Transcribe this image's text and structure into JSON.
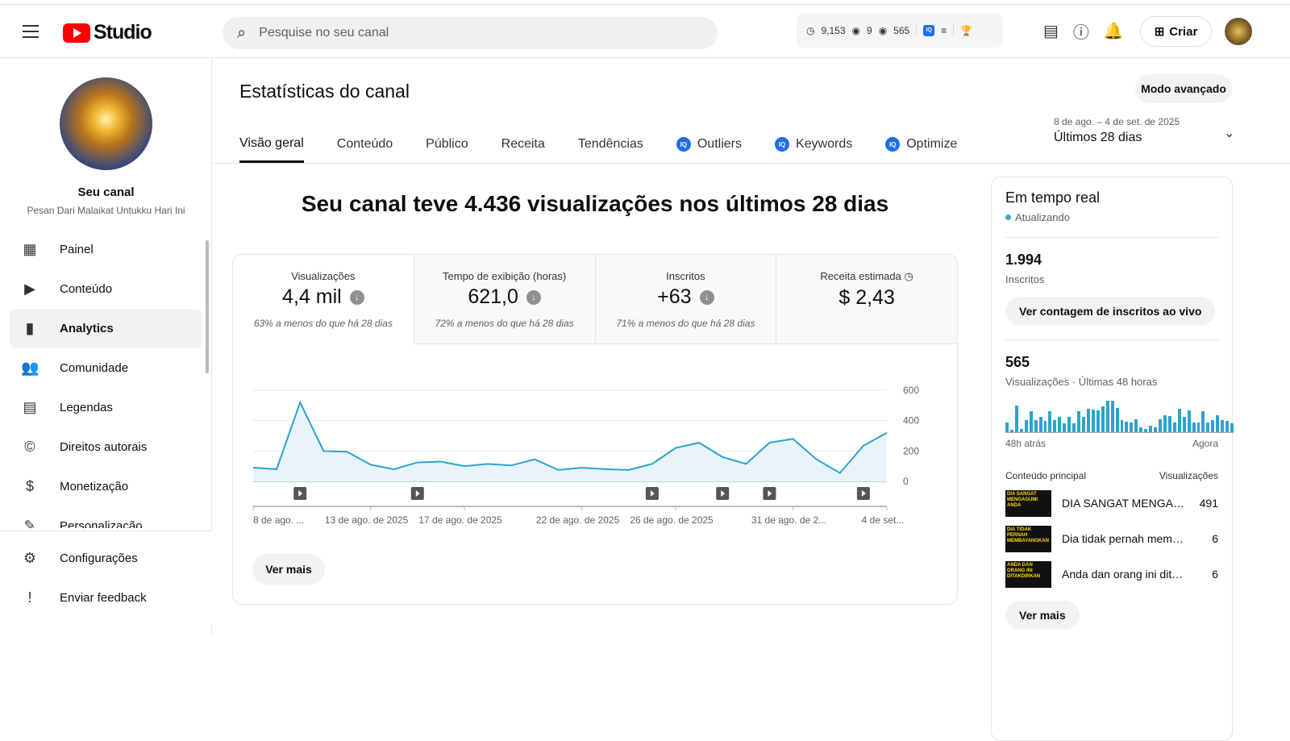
{
  "header": {
    "app": "Studio",
    "search_placeholder": "Pesquise no seu canal",
    "ext_stats": [
      "9,153",
      "9",
      "565"
    ],
    "create_label": "Criar"
  },
  "channel": {
    "title": "Seu canal",
    "name": "Pesan Dari Malaikat Untukku Hari Ini"
  },
  "sidebar": {
    "items": [
      {
        "label": "Painel",
        "icon": "dashboard-icon",
        "glyph": "▦"
      },
      {
        "label": "Conteúdo",
        "icon": "content-icon",
        "glyph": "▶"
      },
      {
        "label": "Analytics",
        "icon": "analytics-icon",
        "glyph": "▮"
      },
      {
        "label": "Comunidade",
        "icon": "community-icon",
        "glyph": "👥"
      },
      {
        "label": "Legendas",
        "icon": "subtitles-icon",
        "glyph": "▤"
      },
      {
        "label": "Direitos autorais",
        "icon": "copyright-icon",
        "glyph": "©"
      },
      {
        "label": "Monetização",
        "icon": "monetization-icon",
        "glyph": "$"
      },
      {
        "label": "Personalização",
        "icon": "customization-icon",
        "glyph": "✎"
      }
    ],
    "bottom": [
      {
        "label": "Configurações",
        "glyph": "⚙"
      },
      {
        "label": "Enviar feedback",
        "glyph": "!"
      }
    ]
  },
  "page": {
    "title": "Estatísticas do canal",
    "advanced_mode": "Modo avançado",
    "tabs": [
      "Visão geral",
      "Conteúdo",
      "Público",
      "Receita",
      "Tendências",
      "Outliers",
      "Keywords",
      "Optimize"
    ],
    "date_range": "8 de ago. – 4 de set. de 2025",
    "period": "Últimos 28 dias",
    "headline": "Seu canal teve 4.436 visualizações nos últimos 28 dias",
    "metrics": [
      {
        "label": "Visualizações",
        "value": "4,4 mil",
        "change": "63% a menos do que há 28 dias"
      },
      {
        "label": "Tempo de exibição (horas)",
        "value": "621,0",
        "change": "72% a menos do que há 28 dias"
      },
      {
        "label": "Inscritos",
        "value": "+63",
        "change": "71% a menos do que há 28 dias"
      },
      {
        "label": "Receita estimada",
        "value": "$ 2,43"
      }
    ],
    "see_more": "Ver mais"
  },
  "chart_data": {
    "type": "area",
    "series": [
      {
        "name": "Visualizações",
        "values": [
          90,
          80,
          520,
          200,
          195,
          110,
          80,
          125,
          130,
          100,
          115,
          105,
          145,
          75,
          90,
          80,
          75,
          115,
          220,
          255,
          160,
          115,
          255,
          280,
          145,
          55,
          235,
          320
        ]
      }
    ],
    "ylim": [
      0,
      600
    ],
    "yticks": [
      "0",
      "200",
      "400",
      "600"
    ],
    "xticks": [
      {
        "i": 0,
        "label": "8 de ago. ..."
      },
      {
        "i": 5,
        "label": "13 de ago. de 2025"
      },
      {
        "i": 9,
        "label": "17 de ago. de 2025"
      },
      {
        "i": 14,
        "label": "22 de ago. de 2025"
      },
      {
        "i": 18,
        "label": "26 de ago. de 2025"
      },
      {
        "i": 23,
        "label": "31 de ago. de 2..."
      },
      {
        "i": 27,
        "label": "4 de set..."
      }
    ],
    "video_markers": [
      2,
      7,
      17,
      20,
      22,
      26
    ],
    "color": "#2ea2cf"
  },
  "realtime": {
    "title": "Em tempo real",
    "status": "Atualizando",
    "subs": "1.994",
    "subs_label": "Inscritos",
    "live_btn": "Ver contagem de inscritos ao vivo",
    "views": "565",
    "views_label": "Visualizações · Últimas 48 horas",
    "bars": [
      14,
      3,
      37,
      5,
      17,
      29,
      17,
      22,
      16,
      29,
      17,
      21,
      12,
      22,
      12,
      29,
      22,
      33,
      32,
      30,
      36,
      44,
      44,
      34,
      17,
      15,
      13,
      18,
      7,
      5,
      9,
      7,
      18,
      24,
      23,
      13,
      33,
      22,
      31,
      13,
      13,
      29,
      13,
      17,
      24,
      17,
      16,
      12
    ],
    "from": "48h atrás",
    "to": "Agora",
    "top_label": "Conteúdo principal",
    "top_views_label": "Visualizações",
    "top": [
      {
        "title": "DIA SANGAT MENGAGUMI ...",
        "views": "491",
        "thumb": "DIA SANGAT MENGAGUMI ANDA"
      },
      {
        "title": "Dia tidak pernah membayang...",
        "views": "6",
        "thumb": "DIA TIDAK PERNAH MEMBAYANGKAN"
      },
      {
        "title": "Anda dan orang ini ditakdirka...",
        "views": "6",
        "thumb": "ANDA DAN ORANG INI DITAKDIRKAN"
      }
    ],
    "see_more": "Ver mais"
  }
}
